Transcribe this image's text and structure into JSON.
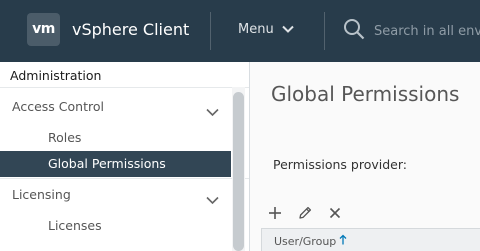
{
  "header": {
    "logo_text": "vm",
    "app_title": "vSphere Client",
    "menu_label": "Menu",
    "search_placeholder": "Search in all envi",
    "background_color": "#283c4b"
  },
  "sidebar": {
    "heading": "Administration",
    "groups": [
      {
        "label": "Access Control",
        "expanded": true,
        "items": [
          {
            "label": "Roles",
            "active": false
          },
          {
            "label": "Global Permissions",
            "active": true
          }
        ]
      },
      {
        "label": "Licensing",
        "expanded": true,
        "items": [
          {
            "label": "Licenses",
            "active": false
          }
        ]
      }
    ],
    "active_color": "#324655"
  },
  "main": {
    "title": "Global Permissions",
    "provider_label": "Permissions provider:",
    "toolbar": {
      "icons": [
        "add-icon",
        "edit-pencil-icon",
        "remove-icon"
      ]
    },
    "grid": {
      "columns": [
        {
          "label": "User/Group",
          "sort": "ascending"
        }
      ]
    }
  }
}
